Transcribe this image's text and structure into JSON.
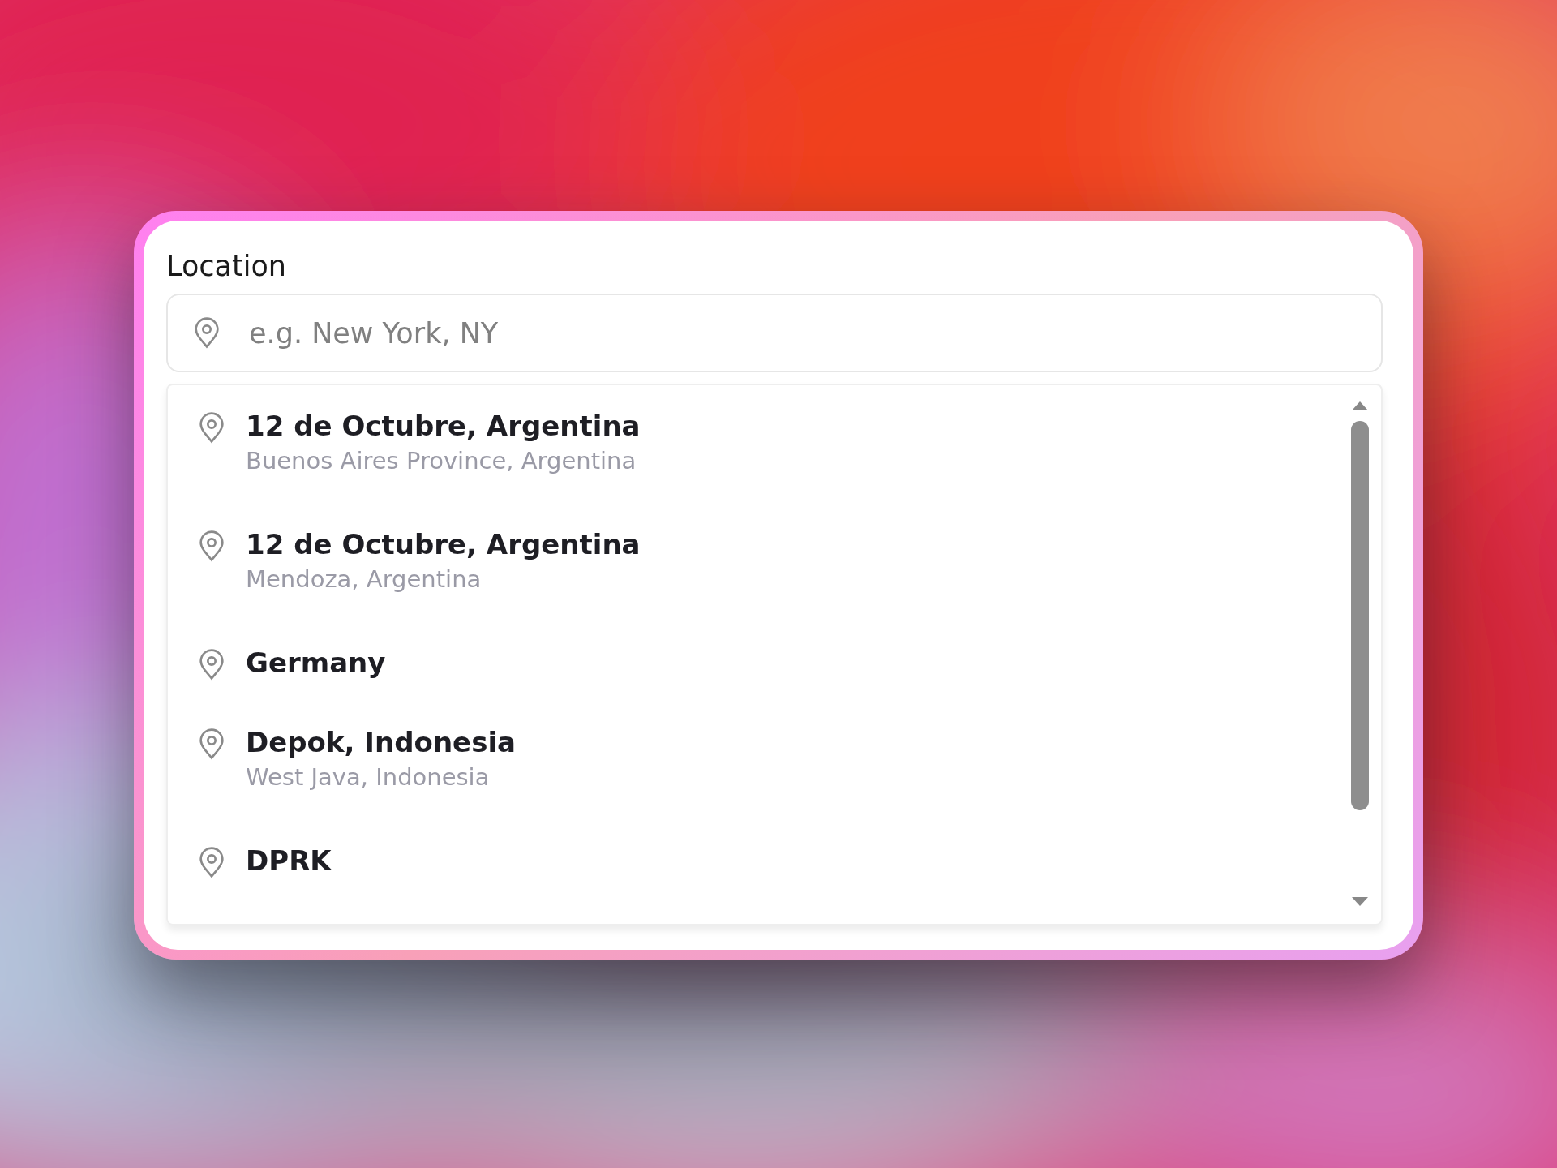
{
  "field": {
    "label": "Location",
    "placeholder": "e.g. New York, NY"
  },
  "suggestions": [
    {
      "title": "12 de Octubre, Argentina",
      "subtitle": "Buenos Aires Province, Argentina"
    },
    {
      "title": "12 de Octubre, Argentina",
      "subtitle": "Mendoza, Argentina"
    },
    {
      "title": "Germany"
    },
    {
      "title": "Depok, Indonesia",
      "subtitle": "West Java, Indonesia"
    },
    {
      "title": "DPRK"
    }
  ]
}
